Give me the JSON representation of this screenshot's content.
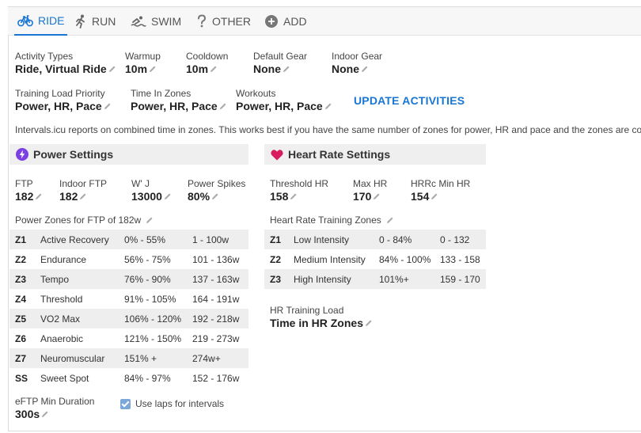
{
  "tabs": [
    {
      "label": "RIDE",
      "icon": "bike-icon",
      "active": true
    },
    {
      "label": "RUN",
      "icon": "run-icon"
    },
    {
      "label": "SWIM",
      "icon": "swim-icon"
    },
    {
      "label": "OTHER",
      "icon": "question-icon"
    },
    {
      "label": "ADD",
      "icon": "add-circle-icon"
    }
  ],
  "general": {
    "activity_types": {
      "label": "Activity Types",
      "value": "Ride, Virtual Ride"
    },
    "warmup": {
      "label": "Warmup",
      "value": "10m"
    },
    "cooldown": {
      "label": "Cooldown",
      "value": "10m"
    },
    "default_gear": {
      "label": "Default Gear",
      "value": "None"
    },
    "indoor_gear": {
      "label": "Indoor Gear",
      "value": "None"
    },
    "training_load_priority": {
      "label": "Training Load Priority",
      "value": "Power, HR, Pace"
    },
    "time_in_zones": {
      "label": "Time In Zones",
      "value": "Power, HR, Pace"
    },
    "workouts": {
      "label": "Workouts",
      "value": "Power, HR, Pace"
    },
    "update_button": "UPDATE ACTIVITIES",
    "info_text": "Intervals.icu reports on combined time in zones. This works best if you have the same number of zones for power, HR and pace and the zones are cor"
  },
  "power": {
    "title": "Power Settings",
    "ftp": {
      "label": "FTP",
      "value": "182"
    },
    "indoor_ftp": {
      "label": "Indoor FTP",
      "value": "182"
    },
    "w_prime": {
      "label": "W' J",
      "value": "13000"
    },
    "power_spikes": {
      "label": "Power Spikes",
      "value": "80%"
    },
    "zones_label": "Power Zones for FTP of 182w",
    "zones": [
      {
        "id": "Z1",
        "name": "Active Recovery",
        "pct": "0% - 55%",
        "watts": "1 - 100w"
      },
      {
        "id": "Z2",
        "name": "Endurance",
        "pct": "56% - 75%",
        "watts": "101 - 136w"
      },
      {
        "id": "Z3",
        "name": "Tempo",
        "pct": "76% - 90%",
        "watts": "137 - 163w"
      },
      {
        "id": "Z4",
        "name": "Threshold",
        "pct": "91% - 105%",
        "watts": "164 - 191w"
      },
      {
        "id": "Z5",
        "name": "VO2 Max",
        "pct": "106% - 120%",
        "watts": "192 - 218w"
      },
      {
        "id": "Z6",
        "name": "Anaerobic",
        "pct": "121% - 150%",
        "watts": "219 - 273w"
      },
      {
        "id": "Z7",
        "name": "Neuromuscular",
        "pct": "151% +",
        "watts": "274w+"
      },
      {
        "id": "SS",
        "name": "Sweet Spot",
        "pct": "84% - 97%",
        "watts": "152 - 176w"
      }
    ],
    "eftp": {
      "label": "eFTP Min Duration",
      "value": "300s"
    },
    "use_laps": {
      "label": "Use laps for intervals",
      "checked": true
    }
  },
  "hr": {
    "title": "Heart Rate Settings",
    "threshold": {
      "label": "Threshold HR",
      "value": "158"
    },
    "max": {
      "label": "Max HR",
      "value": "170"
    },
    "hrrc": {
      "label": "HRRc Min HR",
      "value": "154"
    },
    "zones_label": "Heart Rate Training Zones",
    "zones": [
      {
        "id": "Z1",
        "name": "Low Intensity",
        "pct": "0 - 84%",
        "bpm": "0 - 132"
      },
      {
        "id": "Z2",
        "name": "Medium Intensity",
        "pct": "84% - 100%",
        "bpm": "133 - 158"
      },
      {
        "id": "Z3",
        "name": "High Intensity",
        "pct": "101%+",
        "bpm": "159 - 170"
      }
    ],
    "training_load": {
      "label": "HR Training Load",
      "value": "Time in HR Zones"
    }
  },
  "colors": {
    "accent": "#1976d2",
    "power_icon": "#7b3fe4",
    "heart_icon": "#d81b60"
  }
}
